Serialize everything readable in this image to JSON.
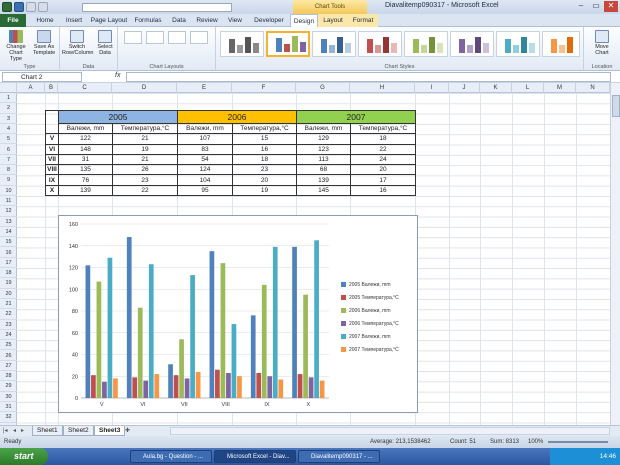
{
  "window": {
    "title": "Diavalitemp090317 - Microsoft Excel",
    "chart_tools_label": "Chart Tools"
  },
  "tabs": [
    "File",
    "Home",
    "Insert",
    "Page Layout",
    "Formulas",
    "Data",
    "Review",
    "View",
    "Developer",
    "Design",
    "Layout",
    "Format"
  ],
  "ribbon": {
    "change_chart_type": "Change Chart Type",
    "save_as_template": "Save As Template",
    "switch_row_column": "Switch Row/Column",
    "select_data": "Select Data",
    "move_chart": "Move Chart",
    "groups": {
      "type": "Type",
      "data": "Data",
      "chart_layouts": "Chart Layouts",
      "chart_styles": "Chart Styles",
      "location": "Location"
    }
  },
  "formula_bar": {
    "name_box": "Chart 2",
    "fx": "fx",
    "value": ""
  },
  "columns": [
    "A",
    "B",
    "C",
    "D",
    "E",
    "F",
    "G",
    "H",
    "I",
    "J",
    "K",
    "L",
    "M",
    "N"
  ],
  "rows": [
    "1",
    "2",
    "3",
    "4",
    "5",
    "6",
    "7",
    "8",
    "9",
    "10",
    "11",
    "12",
    "13",
    "14",
    "15",
    "16",
    "17",
    "18",
    "19",
    "20",
    "21",
    "22",
    "23",
    "24",
    "25",
    "26",
    "27",
    "28",
    "29",
    "30",
    "31",
    "32"
  ],
  "table": {
    "years": [
      "2005",
      "2006",
      "2007"
    ],
    "year_colors": [
      "#8db4e2",
      "#ffc000",
      "#92d050"
    ],
    "sub_headers": [
      "Валежи, mm",
      "Температура,°C"
    ],
    "rows": [
      {
        "label": "V",
        "values": [
          "122",
          "21",
          "107",
          "15",
          "129",
          "18"
        ]
      },
      {
        "label": "VI",
        "values": [
          "148",
          "19",
          "83",
          "16",
          "123",
          "22"
        ]
      },
      {
        "label": "VII",
        "values": [
          "31",
          "21",
          "54",
          "18",
          "113",
          "24"
        ]
      },
      {
        "label": "VIII",
        "values": [
          "135",
          "26",
          "124",
          "23",
          "68",
          "20"
        ]
      },
      {
        "label": "IX",
        "values": [
          "76",
          "23",
          "104",
          "20",
          "139",
          "17"
        ]
      },
      {
        "label": "X",
        "values": [
          "139",
          "22",
          "95",
          "19",
          "145",
          "16"
        ]
      }
    ]
  },
  "chart_data": {
    "type": "bar",
    "categories": [
      "V",
      "VI",
      "VII",
      "VIII",
      "IX",
      "X"
    ],
    "ylim": [
      0,
      160
    ],
    "yticks": [
      "0",
      "20",
      "40",
      "60",
      "80",
      "100",
      "120",
      "140",
      "160"
    ],
    "legend_position": "right",
    "series": [
      {
        "name": "2005 Валежи, mm",
        "color": "#4f81bd",
        "values": [
          122,
          148,
          31,
          135,
          76,
          139
        ]
      },
      {
        "name": "2005 Температура,°C",
        "color": "#c0504d",
        "values": [
          21,
          19,
          21,
          26,
          23,
          22
        ]
      },
      {
        "name": "2006 Валежи, mm",
        "color": "#9bbb59",
        "values": [
          107,
          83,
          54,
          124,
          104,
          95
        ]
      },
      {
        "name": "2006 Температура,°C",
        "color": "#8064a2",
        "values": [
          15,
          16,
          18,
          23,
          20,
          19
        ]
      },
      {
        "name": "2007 Валежи, mm",
        "color": "#4bacc6",
        "values": [
          129,
          123,
          113,
          68,
          139,
          145
        ]
      },
      {
        "name": "2007 Температура,°C",
        "color": "#f79646",
        "values": [
          18,
          22,
          24,
          20,
          17,
          16
        ]
      }
    ]
  },
  "sheets": [
    "Sheet1",
    "Sheet2",
    "Sheet3"
  ],
  "status": {
    "ready": "Ready",
    "average": "Average: 213,1538462",
    "count": "Count: 51",
    "sum": "Sum: 8313",
    "zoom": "100%"
  },
  "taskbar": {
    "start": "start",
    "items": [
      "Aula.bg - Question - ...",
      "Microsoft Excel - Diav...",
      "Diavalitemp090317 - ..."
    ],
    "clock": "14:46"
  }
}
